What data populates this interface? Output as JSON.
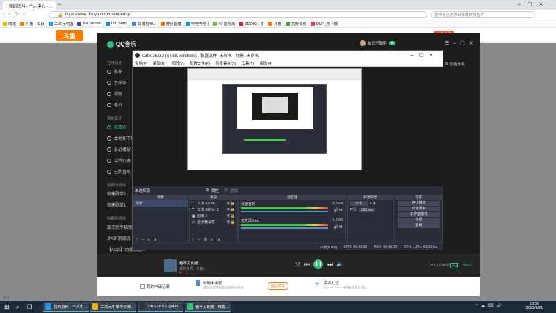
{
  "browser": {
    "tabs": [
      {
        "label": "我的资料 - 个人中心 - ..."
      }
    ],
    "url": "https://www.douyu.com/member/cp",
    "search_placeholder": "提申报已提供日本嫌疑的图片",
    "bookmarks": [
      "收藏",
      "斗鱼 - 每日",
      "二次元中国",
      "Bai Sensei",
      "LoL Stats,",
      "百度拾呀...",
      "虎牙直播",
      "哔哩哔哩 (",
      "40 冒险岛",
      "ZEO93 / 冒",
      "斗鱼",
      "免费视频",
      "DNF_地下城"
    ],
    "status_left": "完成"
  },
  "site": {
    "logo": "斗鱼",
    "right_badge": "斗鱼会员"
  },
  "qq": {
    "brand": "QQ音乐",
    "user": "依旧不聪明",
    "right_link": "智能分类",
    "sections": [
      {
        "header": "在线音乐",
        "items": [
          "推荐",
          "音乐馆",
          "视频",
          "电台"
        ]
      },
      {
        "header": "我的音乐",
        "items": [
          "我喜欢",
          "本地和下载",
          "最近播放",
          "试听列表",
          "已购音乐"
        ]
      },
      {
        "header": "创建的歌单",
        "items": [
          "新建歌单2",
          "新建歌单1"
        ]
      },
      {
        "header": "收藏的歌单",
        "items": [
          "周杰伦专辑精选汇总...",
          "JPOP洞潮流",
          "【ACG】动漫精选..."
        ]
      }
    ],
    "now_playing": {
      "title": "看不见的暖...",
      "artist": "我的世界 · 乐曲...",
      "time": "02:01 / 04:00",
      "quality": "SQ",
      "extra": "999+"
    },
    "bottom": [
      {
        "label": "我的申请记录"
      },
      {
        "title": "邮箱未绑定",
        "desc": "绑定后可找回密码和申领更多",
        "btn": "前往绑定"
      },
      {
        "title": "实名认证",
        "desc": "42*************8已通过实名认证"
      }
    ]
  },
  "obs": {
    "title": "OBS 26.0.2 (64-bit, windows) - 配置文件: 未命名 - 场景: 未命名",
    "menu": [
      "文件(F)",
      "编辑(E)",
      "视图(V)",
      "配置文件(P)",
      "场景集合(S)",
      "工具(T)",
      "帮助(H)"
    ],
    "status_line": "未选择源",
    "prop_btn": "属性",
    "filter_btn": "滤镜",
    "docks": {
      "scenes": {
        "header": "场景",
        "items": [
          "场景"
        ]
      },
      "sources": {
        "header": "来源",
        "items": [
          "文本 (GDI+)",
          "文本 (GDI+) 2",
          "图像 2",
          "显示器采集"
        ]
      },
      "mixer": {
        "header": "混音器",
        "tracks": [
          {
            "name": "桌面音频",
            "db": "0.0 dB"
          },
          {
            "name": "麦克风/Aux",
            "db": "0.0 dB"
          }
        ]
      },
      "transitions": {
        "header": "转场特效",
        "type": "淡出",
        "duration_label": "时长",
        "duration": "300 ms"
      },
      "controls": {
        "header": "控件",
        "buttons": [
          "停止推流",
          "开始录制",
          "工作室模式",
          "设置",
          "退出"
        ]
      }
    },
    "statusbar": {
      "live": "LIVE: 00:00:00",
      "rec": "REC: 00:00:00",
      "cpu": "CPU: 1.2%, 60.00 fps",
      "dropped": "12帧(0.0%)"
    }
  },
  "taskbar": {
    "apps": [
      "我的资料 - 个人中...",
      "二次元中事华帧频...",
      "OBS 26.0.2 (64-bi...",
      "看不见的暖 - 林嘉..."
    ],
    "time": "13:36",
    "date": "2022/6/21"
  },
  "colors": {
    "qq_green": "#31c27c",
    "obs_bg": "#2b2e38",
    "taskbar": "#1c2b3a",
    "douyu_orange": "#ff7a00"
  }
}
